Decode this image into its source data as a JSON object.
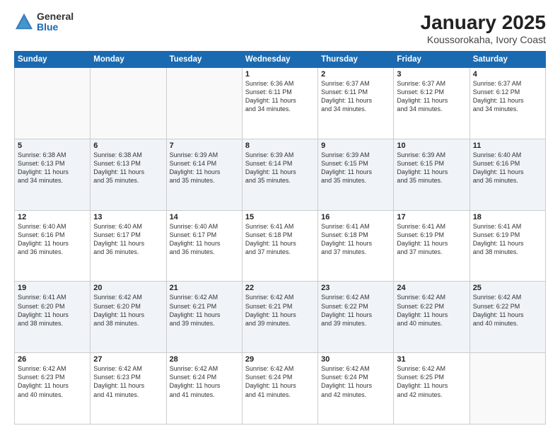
{
  "logo": {
    "general": "General",
    "blue": "Blue"
  },
  "header": {
    "month": "January 2025",
    "location": "Koussorokaha, Ivory Coast"
  },
  "weekdays": [
    "Sunday",
    "Monday",
    "Tuesday",
    "Wednesday",
    "Thursday",
    "Friday",
    "Saturday"
  ],
  "weeks": [
    [
      {
        "day": "",
        "info": ""
      },
      {
        "day": "",
        "info": ""
      },
      {
        "day": "",
        "info": ""
      },
      {
        "day": "1",
        "info": "Sunrise: 6:36 AM\nSunset: 6:11 PM\nDaylight: 11 hours\nand 34 minutes."
      },
      {
        "day": "2",
        "info": "Sunrise: 6:37 AM\nSunset: 6:11 PM\nDaylight: 11 hours\nand 34 minutes."
      },
      {
        "day": "3",
        "info": "Sunrise: 6:37 AM\nSunset: 6:12 PM\nDaylight: 11 hours\nand 34 minutes."
      },
      {
        "day": "4",
        "info": "Sunrise: 6:37 AM\nSunset: 6:12 PM\nDaylight: 11 hours\nand 34 minutes."
      }
    ],
    [
      {
        "day": "5",
        "info": "Sunrise: 6:38 AM\nSunset: 6:13 PM\nDaylight: 11 hours\nand 34 minutes."
      },
      {
        "day": "6",
        "info": "Sunrise: 6:38 AM\nSunset: 6:13 PM\nDaylight: 11 hours\nand 35 minutes."
      },
      {
        "day": "7",
        "info": "Sunrise: 6:39 AM\nSunset: 6:14 PM\nDaylight: 11 hours\nand 35 minutes."
      },
      {
        "day": "8",
        "info": "Sunrise: 6:39 AM\nSunset: 6:14 PM\nDaylight: 11 hours\nand 35 minutes."
      },
      {
        "day": "9",
        "info": "Sunrise: 6:39 AM\nSunset: 6:15 PM\nDaylight: 11 hours\nand 35 minutes."
      },
      {
        "day": "10",
        "info": "Sunrise: 6:39 AM\nSunset: 6:15 PM\nDaylight: 11 hours\nand 35 minutes."
      },
      {
        "day": "11",
        "info": "Sunrise: 6:40 AM\nSunset: 6:16 PM\nDaylight: 11 hours\nand 36 minutes."
      }
    ],
    [
      {
        "day": "12",
        "info": "Sunrise: 6:40 AM\nSunset: 6:16 PM\nDaylight: 11 hours\nand 36 minutes."
      },
      {
        "day": "13",
        "info": "Sunrise: 6:40 AM\nSunset: 6:17 PM\nDaylight: 11 hours\nand 36 minutes."
      },
      {
        "day": "14",
        "info": "Sunrise: 6:40 AM\nSunset: 6:17 PM\nDaylight: 11 hours\nand 36 minutes."
      },
      {
        "day": "15",
        "info": "Sunrise: 6:41 AM\nSunset: 6:18 PM\nDaylight: 11 hours\nand 37 minutes."
      },
      {
        "day": "16",
        "info": "Sunrise: 6:41 AM\nSunset: 6:18 PM\nDaylight: 11 hours\nand 37 minutes."
      },
      {
        "day": "17",
        "info": "Sunrise: 6:41 AM\nSunset: 6:19 PM\nDaylight: 11 hours\nand 37 minutes."
      },
      {
        "day": "18",
        "info": "Sunrise: 6:41 AM\nSunset: 6:19 PM\nDaylight: 11 hours\nand 38 minutes."
      }
    ],
    [
      {
        "day": "19",
        "info": "Sunrise: 6:41 AM\nSunset: 6:20 PM\nDaylight: 11 hours\nand 38 minutes."
      },
      {
        "day": "20",
        "info": "Sunrise: 6:42 AM\nSunset: 6:20 PM\nDaylight: 11 hours\nand 38 minutes."
      },
      {
        "day": "21",
        "info": "Sunrise: 6:42 AM\nSunset: 6:21 PM\nDaylight: 11 hours\nand 39 minutes."
      },
      {
        "day": "22",
        "info": "Sunrise: 6:42 AM\nSunset: 6:21 PM\nDaylight: 11 hours\nand 39 minutes."
      },
      {
        "day": "23",
        "info": "Sunrise: 6:42 AM\nSunset: 6:22 PM\nDaylight: 11 hours\nand 39 minutes."
      },
      {
        "day": "24",
        "info": "Sunrise: 6:42 AM\nSunset: 6:22 PM\nDaylight: 11 hours\nand 40 minutes."
      },
      {
        "day": "25",
        "info": "Sunrise: 6:42 AM\nSunset: 6:22 PM\nDaylight: 11 hours\nand 40 minutes."
      }
    ],
    [
      {
        "day": "26",
        "info": "Sunrise: 6:42 AM\nSunset: 6:23 PM\nDaylight: 11 hours\nand 40 minutes."
      },
      {
        "day": "27",
        "info": "Sunrise: 6:42 AM\nSunset: 6:23 PM\nDaylight: 11 hours\nand 41 minutes."
      },
      {
        "day": "28",
        "info": "Sunrise: 6:42 AM\nSunset: 6:24 PM\nDaylight: 11 hours\nand 41 minutes."
      },
      {
        "day": "29",
        "info": "Sunrise: 6:42 AM\nSunset: 6:24 PM\nDaylight: 11 hours\nand 41 minutes."
      },
      {
        "day": "30",
        "info": "Sunrise: 6:42 AM\nSunset: 6:24 PM\nDaylight: 11 hours\nand 42 minutes."
      },
      {
        "day": "31",
        "info": "Sunrise: 6:42 AM\nSunset: 6:25 PM\nDaylight: 11 hours\nand 42 minutes."
      },
      {
        "day": "",
        "info": ""
      }
    ]
  ]
}
